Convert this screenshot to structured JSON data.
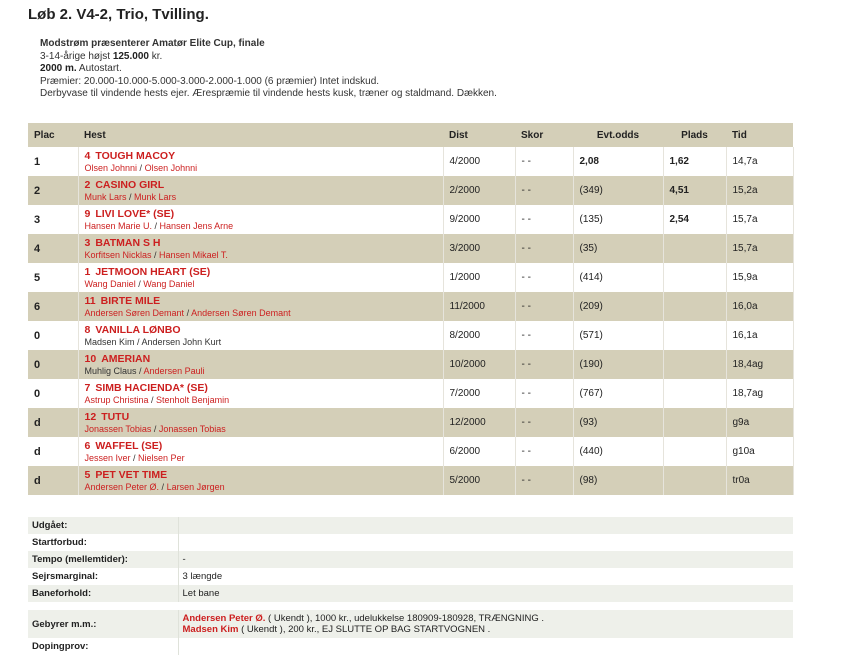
{
  "title": "Løb 2. V4-2, Trio, Tvilling.",
  "race": {
    "name": "Modstrøm præsenterer Amatør Elite Cup, finale",
    "cond_prefix": "3-14-årige højst ",
    "cond_amount": "125.000",
    "cond_suffix": " kr.",
    "distance": "2000 m.",
    "start_type": " Autostart.",
    "prizes": "Præmier: 20.000-10.000-5.000-3.000-2.000-1.000 (6 præmier) Intet indskud.",
    "honors": "Derbyvase til vindende hests ejer. Ærespræmie til vindende hests kusk, træner og staldmand. Dækken."
  },
  "columns": {
    "plac": "Plac",
    "hest": "Hest",
    "dist": "Dist",
    "skor": "Skor",
    "odds": "Evt.odds",
    "plads": "Plads",
    "tid": "Tid"
  },
  "results": [
    {
      "plac": "1",
      "num": "4",
      "horse": "TOUGH MACOY",
      "d1": "Olsen Johnni",
      "d1red": true,
      "d2": "Olsen Johnni",
      "d2red": true,
      "dist": "4/2000",
      "skor": "- -",
      "odds": "2,08",
      "odds_bold": true,
      "plads": "1,62",
      "tid": "14,7a"
    },
    {
      "plac": "2",
      "num": "2",
      "horse": "CASINO GIRL",
      "d1": "Munk Lars",
      "d1red": true,
      "d2": "Munk Lars",
      "d2red": true,
      "dist": "2/2000",
      "skor": "- -",
      "odds": "(349)",
      "odds_bold": false,
      "plads": "4,51",
      "tid": "15,2a"
    },
    {
      "plac": "3",
      "num": "9",
      "horse": "LIVI LOVE* (SE)",
      "d1": "Hansen Marie U.",
      "d1red": true,
      "d2": "Hansen Jens Arne",
      "d2red": true,
      "dist": "9/2000",
      "skor": "- -",
      "odds": "(135)",
      "odds_bold": false,
      "plads": "2,54",
      "tid": "15,7a"
    },
    {
      "plac": "4",
      "num": "3",
      "horse": "BATMAN S H",
      "d1": "Korfitsen Nicklas",
      "d1red": true,
      "d2": "Hansen Mikael T.",
      "d2red": true,
      "dist": "3/2000",
      "skor": "- -",
      "odds": "(35)",
      "odds_bold": false,
      "plads": "",
      "tid": "15,7a"
    },
    {
      "plac": "5",
      "num": "1",
      "horse": "JETMOON HEART (SE)",
      "d1": "Wang Daniel",
      "d1red": true,
      "d2": "Wang Daniel",
      "d2red": true,
      "dist": "1/2000",
      "skor": "- -",
      "odds": "(414)",
      "odds_bold": false,
      "plads": "",
      "tid": "15,9a"
    },
    {
      "plac": "6",
      "num": "11",
      "horse": "BIRTE MILE",
      "d1": "Andersen Søren Demant",
      "d1red": true,
      "d2": "Andersen Søren Demant",
      "d2red": true,
      "dist": "11/2000",
      "skor": "- -",
      "odds": "(209)",
      "odds_bold": false,
      "plads": "",
      "tid": "16,0a"
    },
    {
      "plac": "0",
      "num": "8",
      "horse": "VANILLA LØNBO",
      "d1": "Madsen Kim",
      "d1red": false,
      "d2": "Andersen John Kurt",
      "d2red": false,
      "dist": "8/2000",
      "skor": "- -",
      "odds": "(571)",
      "odds_bold": false,
      "plads": "",
      "tid": "16,1a"
    },
    {
      "plac": "0",
      "num": "10",
      "horse": "AMERIAN",
      "d1": "Muhlig Claus",
      "d1red": false,
      "d2": "Andersen Pauli",
      "d2red": true,
      "dist": "10/2000",
      "skor": "- -",
      "odds": "(190)",
      "odds_bold": false,
      "plads": "",
      "tid": "18,4ag"
    },
    {
      "plac": "0",
      "num": "7",
      "horse": "SIMB HACIENDA* (SE)",
      "d1": "Astrup Christina",
      "d1red": true,
      "d2": "Stenholt Benjamin",
      "d2red": true,
      "dist": "7/2000",
      "skor": "- -",
      "odds": "(767)",
      "odds_bold": false,
      "plads": "",
      "tid": "18,7ag"
    },
    {
      "plac": "d",
      "num": "12",
      "horse": "TUTU",
      "d1": "Jonassen Tobias",
      "d1red": true,
      "d2": "Jonassen Tobias",
      "d2red": true,
      "dist": "12/2000",
      "skor": "- -",
      "odds": "(93)",
      "odds_bold": false,
      "plads": "",
      "tid": "g9a"
    },
    {
      "plac": "d",
      "num": "6",
      "horse": "WAFFEL (SE)",
      "d1": "Jessen Iver",
      "d1red": true,
      "d2": "Nielsen Per",
      "d2red": true,
      "dist": "6/2000",
      "skor": "- -",
      "odds": "(440)",
      "odds_bold": false,
      "plads": "",
      "tid": "g10a"
    },
    {
      "plac": "d",
      "num": "5",
      "horse": "PET VET TIME",
      "d1": "Andersen Peter Ø.",
      "d1red": true,
      "d2": "Larsen Jørgen",
      "d2red": true,
      "dist": "5/2000",
      "skor": "- -",
      "odds": "(98)",
      "odds_bold": false,
      "plads": "",
      "tid": "tr0a"
    }
  ],
  "facts": {
    "udgaaet_label": "Udgået:",
    "udgaaet_value": "",
    "startforbud_label": "Startforbud:",
    "startforbud_value": "",
    "tempo_label": "Tempo (mellemtider):",
    "tempo_value": "-",
    "sejr_label": "Sejrsmarginal:",
    "sejr_value": "3 længde",
    "bane_label": "Baneforhold:",
    "bane_value": "Let bane",
    "gebyr_label": "Gebyrer m.m.:",
    "gebyr_lines": [
      {
        "who": "Andersen Peter Ø.",
        "text": " ( Ukendt ), 1000 kr., udelukkelse 180909-180928, TRÆNGNING ."
      },
      {
        "who": "Madsen Kim",
        "text": " ( Ukendt ), 200 kr., EJ SLUTTE OP BAG STARTVOGNEN ."
      }
    ],
    "doping_label": "Dopingprov:",
    "doping_value": ""
  },
  "colors": {
    "header_bg": "#d4cfb8",
    "accent_red": "#cc1f1f",
    "facts_bg": "#eef0ea"
  }
}
